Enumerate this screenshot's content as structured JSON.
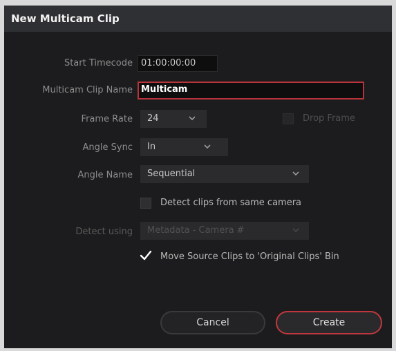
{
  "dialog": {
    "title": "New Multicam Clip",
    "start_timecode": {
      "label": "Start Timecode",
      "value": "01:00:00:00"
    },
    "clip_name": {
      "label": "Multicam Clip Name",
      "value": "Multicam"
    },
    "frame_rate": {
      "label": "Frame Rate",
      "value": "24"
    },
    "drop_frame": {
      "label": "Drop Frame",
      "checked": false,
      "enabled": false
    },
    "angle_sync": {
      "label": "Angle Sync",
      "value": "In"
    },
    "angle_name": {
      "label": "Angle Name",
      "value": "Sequential"
    },
    "detect_same_camera": {
      "label": "Detect clips from same camera",
      "checked": false
    },
    "detect_using": {
      "label": "Detect using",
      "value": "Metadata - Camera #",
      "enabled": false
    },
    "move_source": {
      "label": "Move Source Clips to 'Original Clips' Bin",
      "checked": true
    },
    "cancel_label": "Cancel",
    "create_label": "Create"
  },
  "colors": {
    "accent": "#c0383e",
    "background": "#1c1c1e",
    "titlebar": "#2f3033"
  },
  "icons": [
    "chevron-down-icon",
    "checkmark-icon"
  ]
}
